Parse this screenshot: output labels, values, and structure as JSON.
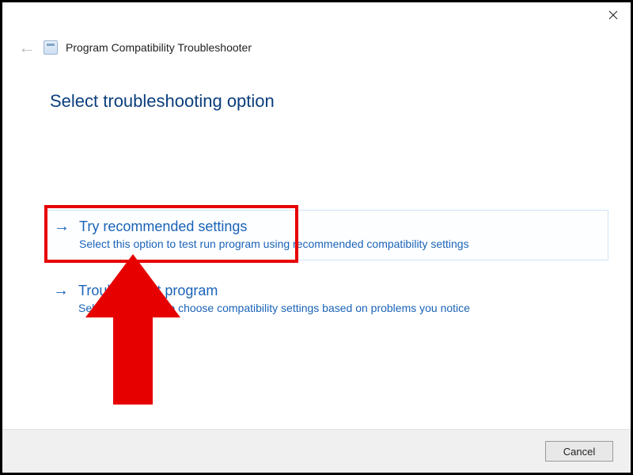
{
  "window": {
    "app_title": "Program Compatibility Troubleshooter"
  },
  "heading": "Select troubleshooting option",
  "options": [
    {
      "title": "Try recommended settings",
      "desc": "Select this option to test run program using recommended compatibility settings"
    },
    {
      "title": "Troubleshoot program",
      "desc": "Select this option to choose compatibility settings based on problems you notice"
    }
  ],
  "footer": {
    "cancel_label": "Cancel"
  },
  "annotation": {
    "highlight_target": "Try recommended settings",
    "arrow_color": "#e70000"
  }
}
